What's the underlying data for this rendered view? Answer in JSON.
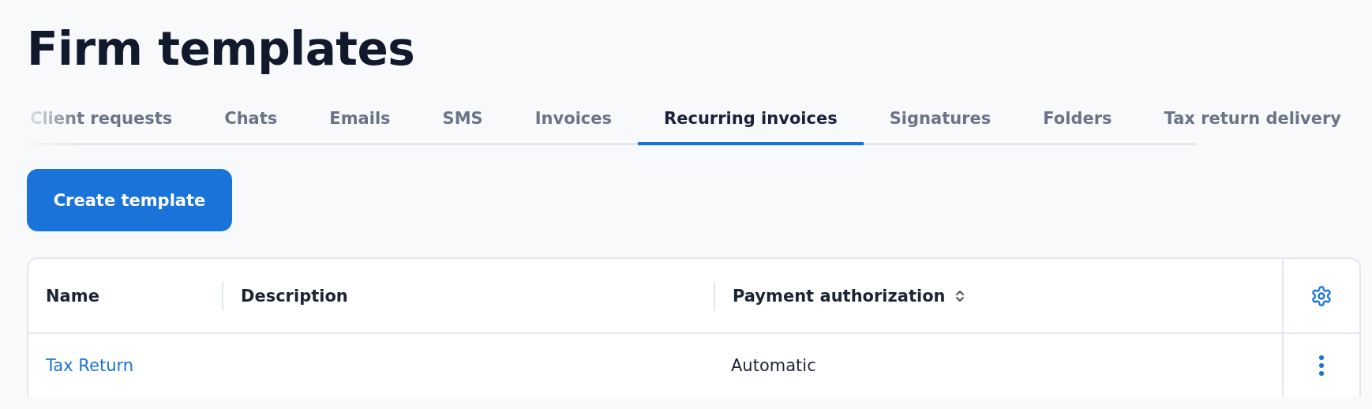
{
  "page": {
    "title": "Firm templates"
  },
  "tabs": [
    {
      "label": "Client requests",
      "selected": false
    },
    {
      "label": "Chats",
      "selected": false
    },
    {
      "label": "Emails",
      "selected": false
    },
    {
      "label": "SMS",
      "selected": false
    },
    {
      "label": "Invoices",
      "selected": false
    },
    {
      "label": "Recurring invoices",
      "selected": true
    },
    {
      "label": "Signatures",
      "selected": false
    },
    {
      "label": "Folders",
      "selected": false
    },
    {
      "label": "Tax return delivery",
      "selected": false
    }
  ],
  "create_button": "Create template",
  "table": {
    "columns": [
      {
        "label": "Name",
        "sortable": false
      },
      {
        "label": "Description",
        "sortable": false
      },
      {
        "label": "Payment authorization",
        "sortable": true
      }
    ],
    "rows": [
      {
        "name": "Tax Return",
        "payment_authorization": "Automatic"
      }
    ]
  }
}
